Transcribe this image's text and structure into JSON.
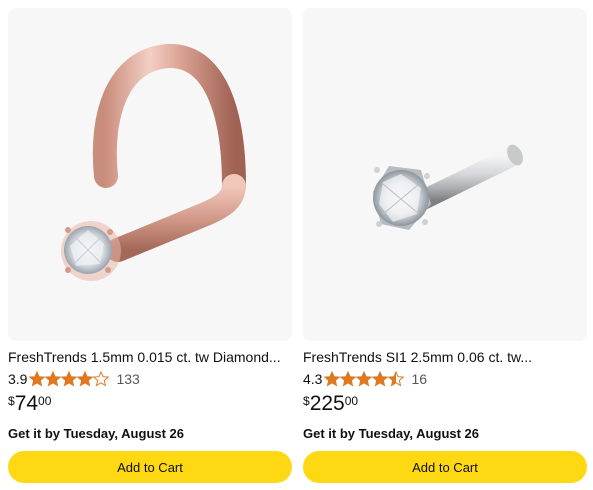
{
  "products": [
    {
      "title": "FreshTrends 1.5mm 0.015 ct. tw Diamond...",
      "rating": "3.9",
      "stars_value": 3.9,
      "review_count": "133",
      "price_symbol": "$",
      "price_whole": "74",
      "price_fraction": "00",
      "delivery": "Get it by Tuesday, August 26",
      "button_label": "Add to Cart",
      "image_desc": "rose-gold-screw-nose-stud-image"
    },
    {
      "title": "FreshTrends SI1 2.5mm 0.06 ct. tw...",
      "rating": "4.3",
      "stars_value": 4.5,
      "review_count": "16",
      "price_symbol": "$",
      "price_whole": "225",
      "price_fraction": "00",
      "delivery": "Get it by Tuesday, August 26",
      "button_label": "Add to Cart",
      "image_desc": "white-gold-nose-bone-stud-image"
    }
  ],
  "colors": {
    "star": "#de7921",
    "button": "#ffd814",
    "image_bg": "#f7f7f7",
    "muted_text": "#565959"
  }
}
